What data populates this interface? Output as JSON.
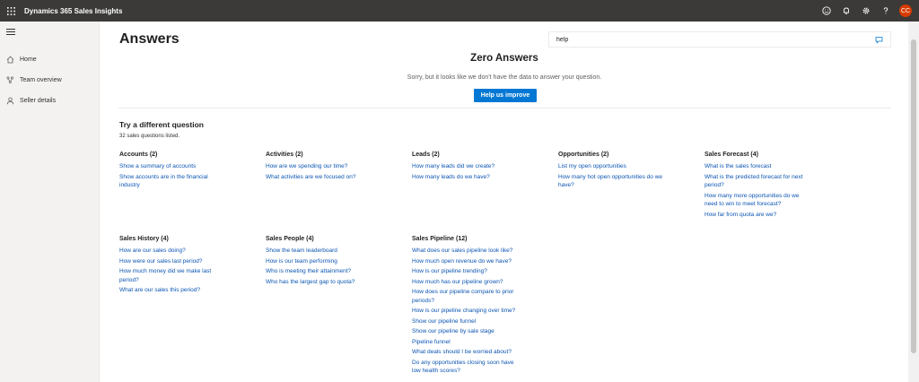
{
  "app": {
    "title": "Dynamics 365 Sales Insights"
  },
  "topbar": {
    "avatar_initials": "CC",
    "icons": [
      "smiley-icon",
      "bell-icon",
      "gear-icon",
      "help-icon"
    ]
  },
  "nav": {
    "items": [
      {
        "label": "Home",
        "icon": "home-icon"
      },
      {
        "label": "Team overview",
        "icon": "team-icon"
      },
      {
        "label": "Seller details",
        "icon": "person-icon"
      }
    ]
  },
  "page": {
    "title": "Answers"
  },
  "search": {
    "value": "help",
    "placeholder": ""
  },
  "result": {
    "title": "Zero Answers",
    "message": "Sorry, but it looks like we don't have the data to answer your question.",
    "button_label": "Help us improve"
  },
  "suggestions": {
    "title": "Try a different question",
    "count_text": "32 sales questions listed.",
    "categories": [
      {
        "title": "Accounts (2)",
        "questions": [
          "Show a summary of accounts",
          "Show accounts are in the financial industry"
        ]
      },
      {
        "title": "Activities (2)",
        "questions": [
          "How are we spending our time?",
          "What activities are we focused on?"
        ]
      },
      {
        "title": "Leads (2)",
        "questions": [
          "How many leads did we create?",
          "How many leads do we have?"
        ]
      },
      {
        "title": "Opportunities (2)",
        "questions": [
          "List my open opportunities",
          "How many hot open opportunities do we have?"
        ]
      },
      {
        "title": "Sales Forecast (4)",
        "questions": [
          "What is the sales forecast",
          "What is the predicted forecast for next period?",
          "How many more opportunities do we need to win to meet forecast?",
          "How far from quota are we?"
        ]
      },
      {
        "title": "Sales History (4)",
        "questions": [
          "How are our sales doing?",
          "How were our sales last period?",
          "How much money did we make last period?",
          "What are our sales this period?"
        ]
      },
      {
        "title": "Sales People (4)",
        "questions": [
          "Show the team leaderboard",
          "How is our team performing",
          "Who is meeting their attainment?",
          "Who has the largest gap to quota?"
        ]
      },
      {
        "title": "Sales Pipeline (12)",
        "questions": [
          "What does our sales pipeline look like?",
          "How much open revenue do we have?",
          "How is our pipeline trending?",
          "How much has our pipeline grown?",
          "How does our pipeline compare to prior periods?",
          "How is our pipeline changing over time?",
          "Show our pipeline funnel",
          "Show our pipeline by sale stage",
          "Pipeline funnel",
          "What deals should I be worried about?",
          "Do any opportunities closing soon have low health scores?"
        ]
      }
    ]
  }
}
